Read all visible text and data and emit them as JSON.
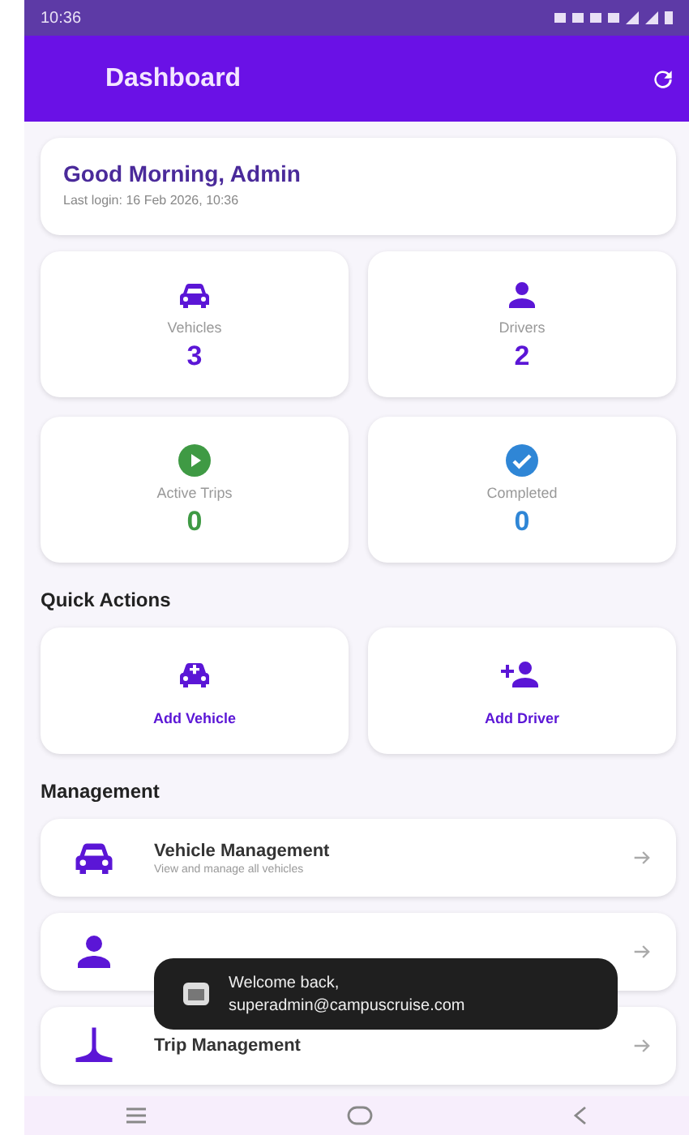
{
  "status_bar": {
    "time": "10:36"
  },
  "app_bar": {
    "title": "Dashboard"
  },
  "greeting": {
    "title": "Good Morning, Admin",
    "subtitle": "Last login: 16 Feb 2026, 10:36"
  },
  "stats": [
    {
      "kind": "vehicle",
      "label": "Vehicles",
      "value": "3",
      "color": "#5b16d6"
    },
    {
      "kind": "driver",
      "label": "Drivers",
      "value": "2",
      "color": "#5b16d6"
    },
    {
      "kind": "active",
      "label": "Active Trips",
      "value": "0",
      "color": "#3f9a44"
    },
    {
      "kind": "completed",
      "label": "Completed",
      "value": "0",
      "color": "#2f86d6"
    }
  ],
  "quick_actions": {
    "heading": "Quick Actions",
    "items": [
      {
        "kind": "add-vehicle",
        "label": "Add Vehicle"
      },
      {
        "kind": "add-driver",
        "label": "Add Driver"
      }
    ]
  },
  "management": {
    "heading": "Management",
    "items": [
      {
        "kind": "vehicle",
        "title": "Vehicle Management",
        "subtitle": "View and manage all vehicles"
      },
      {
        "kind": "driver"
      },
      {
        "kind": "trip",
        "title": "Trip Management"
      }
    ]
  },
  "toast": {
    "line_1": "Welcome back,",
    "line_2": "superadmin@campuscruise.com"
  }
}
